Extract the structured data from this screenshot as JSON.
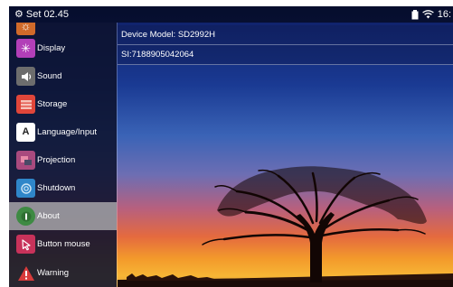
{
  "status_bar": {
    "title": "Set 02.45",
    "time": "16:",
    "icons": [
      "gear-icon",
      "battery-icon",
      "wifi-icon"
    ]
  },
  "sidebar": {
    "active_item": "About",
    "items": [
      {
        "label": "Display",
        "icon": "display-icon",
        "color": "#b23fb8"
      },
      {
        "label": "Sound",
        "icon": "speaker-icon",
        "color": "#6d6d6d"
      },
      {
        "label": "Storage",
        "icon": "storage-icon",
        "color": "#e0463a"
      },
      {
        "label": "Language/Input",
        "icon": "language-icon",
        "color": "#ffffff"
      },
      {
        "label": "Projection",
        "icon": "projection-icon",
        "color": "#a94a7e"
      },
      {
        "label": "Shutdown",
        "icon": "power-icon",
        "color": "#2f86c9"
      },
      {
        "label": "About",
        "icon": "info-icon",
        "color": "#3e8a43"
      },
      {
        "label": "Button mouse",
        "icon": "cursor-icon",
        "color": "#c8325a"
      },
      {
        "label": "Warning",
        "icon": "warning-icon",
        "color": "#d83b3b"
      }
    ]
  },
  "info": {
    "device_model": "Device Model: SD2992H",
    "serial": "SI:7188905042064"
  }
}
